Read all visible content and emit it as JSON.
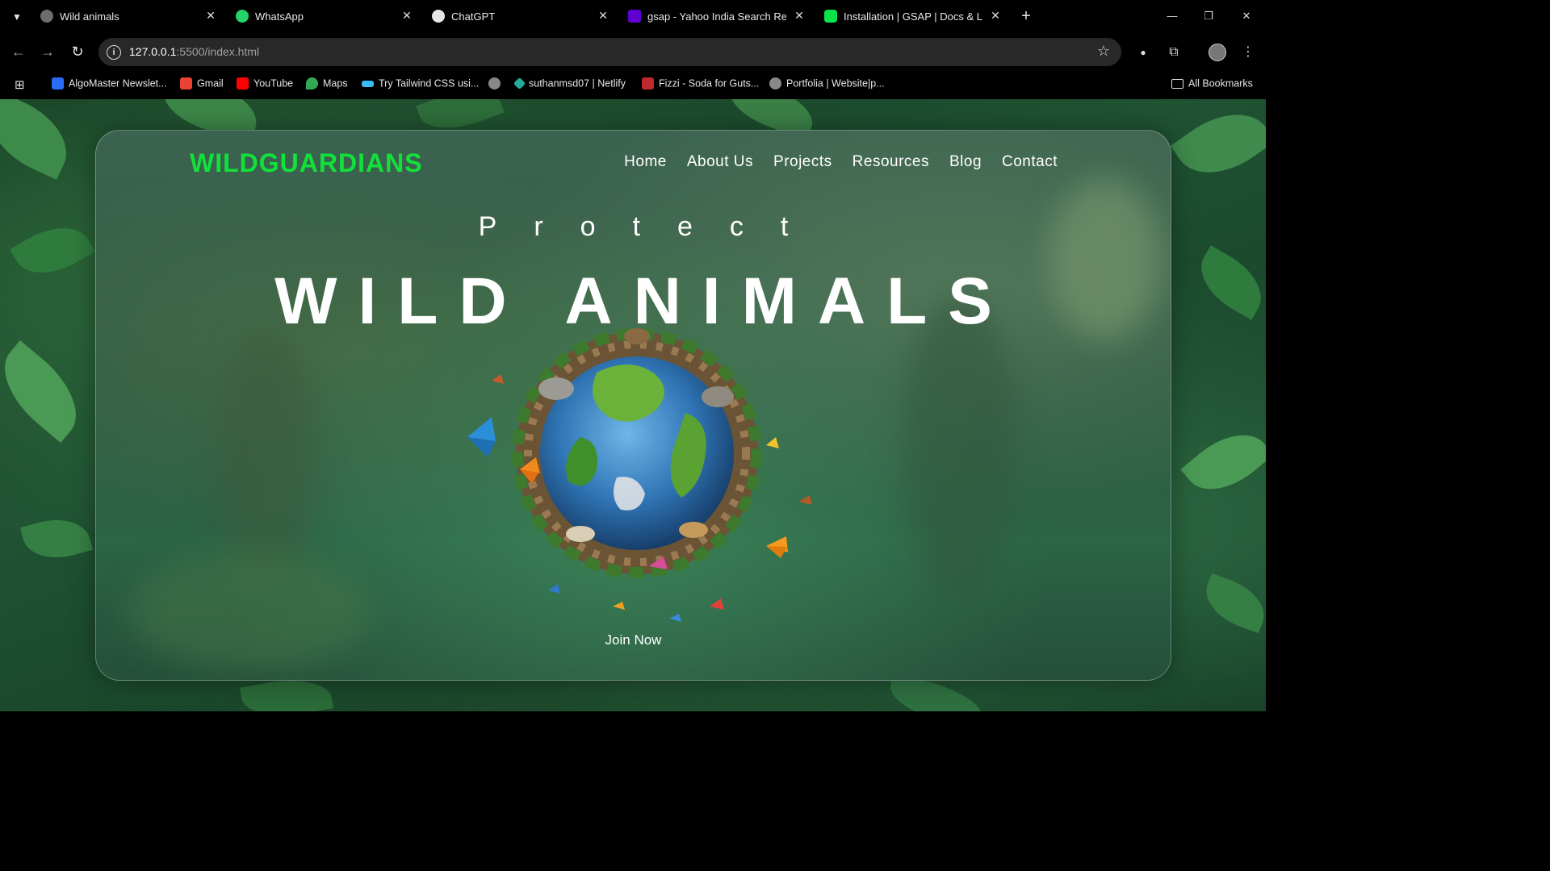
{
  "browser": {
    "tabs": [
      {
        "title": "Wild animals",
        "active": true,
        "icon": "globe-icon"
      },
      {
        "title": "WhatsApp",
        "icon": "whatsapp-icon"
      },
      {
        "title": "ChatGPT",
        "icon": "chatgpt-icon"
      },
      {
        "title": "gsap - Yahoo India Search Resu",
        "icon": "yahoo-icon"
      },
      {
        "title": "Installation | GSAP | Docs & Lea",
        "icon": "gsap-icon"
      }
    ],
    "url_host": "127.0.0.1",
    "url_path": ":5500/index.html",
    "bookmarks": [
      {
        "label": "AlgoMaster Newslet...",
        "color": "#2a6df4"
      },
      {
        "label": "Gmail",
        "color": "#ea4335"
      },
      {
        "label": "YouTube",
        "color": "#ff0000"
      },
      {
        "label": "Maps",
        "color": "#34a853"
      },
      {
        "label": "Try Tailwind CSS usi...",
        "color": "#38bdf8"
      },
      {
        "label": "",
        "color": "#888888"
      },
      {
        "label": "suthanmsd07 | Netlify",
        "color": "#25a99a"
      },
      {
        "label": "Fizzi - Soda for Guts...",
        "color": "#c0282d"
      },
      {
        "label": "Portfolia | Website|p...",
        "color": "#888888"
      }
    ],
    "all_bookmarks": "All Bookmarks"
  },
  "page": {
    "brand": "WILDGUARDIANS",
    "nav": [
      "Home",
      "About Us",
      "Projects",
      "Resources",
      "Blog",
      "Contact"
    ],
    "kicker": "Protect",
    "headline": "WILD ANIMALS",
    "cta": "Join Now"
  },
  "colors": {
    "brand": "#11e23a",
    "text": "#ffffff"
  }
}
